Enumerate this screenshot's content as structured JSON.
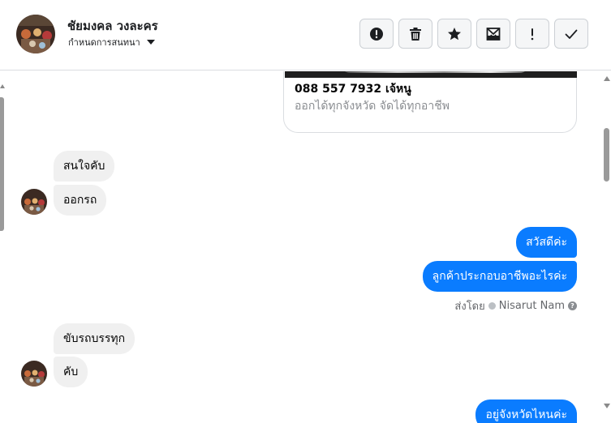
{
  "header": {
    "contact_name": "ชัยมงคล วงละคร",
    "subtitle": "กำหนดการสนทนา",
    "actions": [
      {
        "icon": "alert-circle-icon"
      },
      {
        "icon": "trash-icon"
      },
      {
        "icon": "star-icon"
      },
      {
        "icon": "mark-unread-icon"
      },
      {
        "icon": "exclamation-icon"
      },
      {
        "icon": "check-icon"
      }
    ]
  },
  "card": {
    "title": "088 557 7932 เจ้หนู",
    "description": "ออกได้ทุกจังหวัด จัดได้ทุกอาชีพ"
  },
  "messages": {
    "in_1": "สนใจคับ",
    "in_2": "ออกรถ",
    "out_1": "สวัสดีค่ะ",
    "out_2": "ลูกค้าประกอบอาชีพอะไรค่ะ",
    "sent_by_label": "ส่งโดย",
    "sent_by_name": "Nisarut Nam",
    "in_3": "ขับรถบรรทุก",
    "in_4": "คับ",
    "out_3": "อยู่จังหวัดไหนค่ะ"
  },
  "colors": {
    "outgoing_bubble": "#0a7cff",
    "incoming_bubble": "#f0f0f0"
  }
}
